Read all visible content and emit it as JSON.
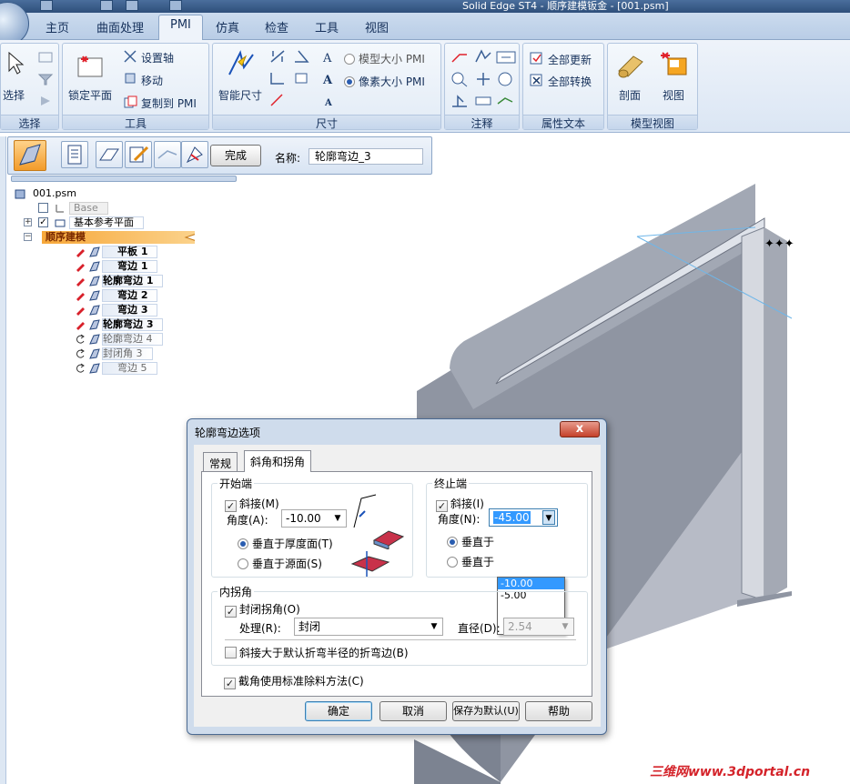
{
  "window": {
    "title": "Solid Edge ST4 - 顺序建模钣金 - [001.psm]"
  },
  "ribbon": {
    "tabs": [
      "主页",
      "曲面处理",
      "PMI",
      "仿真",
      "检查",
      "工具",
      "视图"
    ],
    "active_tab": "PMI",
    "groups": {
      "select": {
        "label": "选择",
        "select_button": "选择"
      },
      "tools": {
        "label": "工具",
        "lock_plane": "锁定平面",
        "set_axis": "设置轴",
        "move": "移动",
        "copy_to_pmi": "复制到 PMI"
      },
      "dimension": {
        "label": "尺寸",
        "smart_dimension": "智能尺寸",
        "model_size_pmi": "模型大小 PMI",
        "pixel_size_pmi": "像素大小 PMI"
      },
      "annotation": {
        "label": "注释"
      },
      "property_text": {
        "label": "属性文本",
        "update_all": "全部更新",
        "convert_all": "全部转换"
      },
      "model_view": {
        "label": "模型视图",
        "section": "剖面",
        "view": "视图"
      }
    }
  },
  "command_bar": {
    "finish_label": "完成",
    "name_label": "名称:",
    "name_value": "轮廓弯边_3"
  },
  "tree": {
    "root": "001.psm",
    "base": "Base",
    "ref_planes": "基本参考平面",
    "sequence": "顺序建模",
    "features": [
      {
        "label": "平板 1",
        "state": "active"
      },
      {
        "label": "弯边 1",
        "state": "active"
      },
      {
        "label": "轮廓弯边 1",
        "state": "active"
      },
      {
        "label": "弯边 2",
        "state": "active"
      },
      {
        "label": "弯边 3",
        "state": "active"
      },
      {
        "label": "轮廓弯边 3",
        "state": "active"
      },
      {
        "label": "轮廓弯边 4",
        "state": "rolled"
      },
      {
        "label": "封闭角 3",
        "state": "rolled"
      },
      {
        "label": "弯边 5",
        "state": "rolled"
      }
    ]
  },
  "dialog": {
    "title": "轮廓弯边选项",
    "close_glyph": "x",
    "tabs": [
      "常规",
      "斜角和拐角"
    ],
    "active_tab": "斜角和拐角",
    "start_end": {
      "legend": "开始端",
      "miter_label": "斜接(M)",
      "miter_checked": true,
      "angle_label": "角度(A):",
      "angle_value": "-10.00",
      "normal_to_thickness": "垂直于厚度面(T)",
      "normal_to_source": "垂直于源面(S)",
      "selected_option": "normal_to_thickness"
    },
    "finish_end": {
      "legend": "终止端",
      "miter_label": "斜接(I)",
      "miter_checked": true,
      "angle_label": "角度(N):",
      "angle_value": "-45.00",
      "radio1_visible": "垂直于",
      "radio2_visible": "垂直于",
      "dropdown_options": [
        "-10.00",
        "-5.00"
      ],
      "dropdown_selected": "-10.00"
    },
    "inner_corner": {
      "legend": "内拐角",
      "close_corner_label": "封闭拐角(O)",
      "close_corner_checked": true,
      "treatment_label": "处理(R):",
      "treatment_value": "封闭",
      "diameter_label": "直径(D):",
      "diameter_value": "2.54",
      "miter_bend_label": "斜接大于默认折弯半径的折弯边(B)",
      "miter_bend_checked": false
    },
    "std_relief_label": "截角使用标准除料方法(C)",
    "std_relief_checked": true,
    "buttons": {
      "ok": "确定",
      "cancel": "取消",
      "save_default": "保存为默认(U)",
      "help": "帮助"
    }
  },
  "watermark": "三维网www.3dportal.cn",
  "colors": {
    "ribbon_bg": "#dbe6f4",
    "accent": "#f29b2a",
    "dialog_frame": "#cfdcec",
    "model_face": "#9aa1ad",
    "watermark": "#d4232a"
  }
}
